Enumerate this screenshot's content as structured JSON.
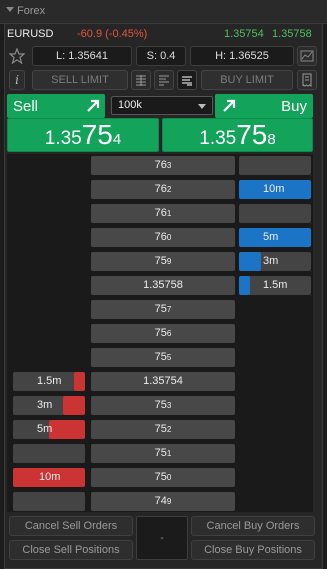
{
  "window": {
    "title": "Forex"
  },
  "symbol": {
    "name": "EURUSD",
    "change": "-60.9 (-0.45%)",
    "bid": "1.35754",
    "ask": "1.35758"
  },
  "stats": {
    "low": "L: 1.35641",
    "spread": "S: 0.4",
    "high": "H: 1.36525"
  },
  "toolbar": {
    "sell_limit": "SELL LIMIT",
    "buy_limit": "BUY LIMIT",
    "info": "i"
  },
  "trade": {
    "sell_label": "Sell",
    "buy_label": "Buy",
    "quantity": "100k",
    "sell_price": {
      "big": "1.35",
      "pips": "75",
      "fraction": "4"
    },
    "buy_price": {
      "big": "1.35",
      "pips": "75",
      "fraction": "8"
    }
  },
  "ladder": {
    "rows": [
      {
        "price_main": "76",
        "price_sub": "3",
        "full": false,
        "sell": null,
        "sell_fill": 0,
        "buy": null,
        "buy_fill": 0,
        "buy_visible": true
      },
      {
        "price_main": "76",
        "price_sub": "2",
        "full": false,
        "sell": null,
        "sell_fill": 0,
        "buy": "10m",
        "buy_fill": 1.0,
        "buy_visible": true
      },
      {
        "price_main": "76",
        "price_sub": "1",
        "full": false,
        "sell": null,
        "sell_fill": 0,
        "buy": null,
        "buy_fill": 0,
        "buy_visible": true
      },
      {
        "price_main": "76",
        "price_sub": "0",
        "full": false,
        "sell": null,
        "sell_fill": 0,
        "buy": "5m",
        "buy_fill": 1.0,
        "buy_visible": true
      },
      {
        "price_main": "75",
        "price_sub": "9",
        "full": false,
        "sell": null,
        "sell_fill": 0,
        "buy": "3m",
        "buy_fill": 0.3,
        "buy_visible": true
      },
      {
        "price_main": "1.35758",
        "price_sub": "",
        "full": true,
        "sell": null,
        "sell_fill": 0,
        "buy": "1.5m",
        "buy_fill": 0.15,
        "buy_visible": true
      },
      {
        "price_main": "75",
        "price_sub": "7",
        "full": false,
        "sell": null,
        "sell_fill": 0,
        "buy": null,
        "buy_fill": 0,
        "buy_visible": false
      },
      {
        "price_main": "75",
        "price_sub": "6",
        "full": false,
        "sell": null,
        "sell_fill": 0,
        "buy": null,
        "buy_fill": 0,
        "buy_visible": false
      },
      {
        "price_main": "75",
        "price_sub": "5",
        "full": false,
        "sell": null,
        "sell_fill": 0,
        "buy": null,
        "buy_fill": 0,
        "buy_visible": false
      },
      {
        "price_main": "1.35754",
        "price_sub": "",
        "full": true,
        "sell": "1.5m",
        "sell_fill": 0.15,
        "buy": null,
        "buy_fill": 0,
        "buy_visible": false
      },
      {
        "price_main": "75",
        "price_sub": "3",
        "full": false,
        "sell": "3m",
        "sell_fill": 0.3,
        "buy": null,
        "buy_fill": 0,
        "buy_visible": false
      },
      {
        "price_main": "75",
        "price_sub": "2",
        "full": false,
        "sell": "5m",
        "sell_fill": 0.5,
        "buy": null,
        "buy_fill": 0,
        "buy_visible": false
      },
      {
        "price_main": "75",
        "price_sub": "1",
        "full": false,
        "sell": null,
        "sell_fill": 0,
        "buy": null,
        "buy_fill": 0,
        "buy_visible": false
      },
      {
        "price_main": "75",
        "price_sub": "0",
        "full": false,
        "sell": "10m",
        "sell_fill": 1.0,
        "buy": null,
        "buy_fill": 0,
        "buy_visible": false
      },
      {
        "price_main": "74",
        "price_sub": "9",
        "full": false,
        "sell": null,
        "sell_fill": 0,
        "buy": null,
        "buy_fill": 0,
        "buy_visible": false
      }
    ]
  },
  "bottom": {
    "cancel_sell": "Cancel Sell Orders",
    "cancel_buy": "Cancel Buy Orders",
    "close_sell": "Close Sell Positions",
    "close_buy": "Close Buy Positions",
    "net": "-"
  },
  "colors": {
    "buy_green": "#13a35a",
    "sell_red": "#cc3333",
    "buy_blue": "#1c74c7",
    "loss": "#e2553f",
    "quote": "#4cc15c"
  }
}
